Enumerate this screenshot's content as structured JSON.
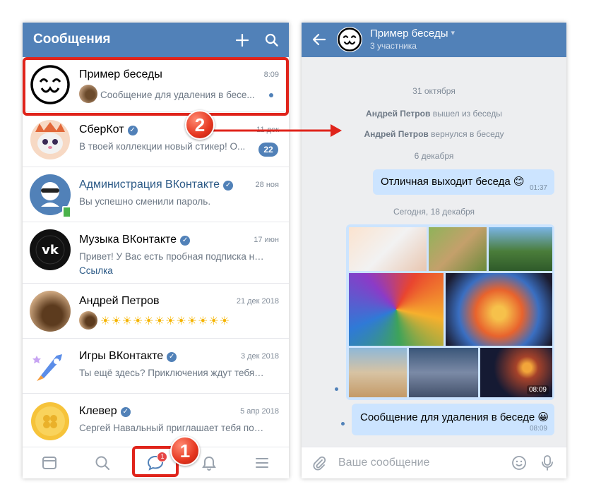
{
  "left": {
    "header_title": "Сообщения",
    "conversations": [
      {
        "name": "Пример беседы",
        "time": "8:09",
        "preview": "Сообщение для удаления в бесе..."
      },
      {
        "name": "СберКот",
        "time": "11 дек",
        "preview": "В твоей коллекции новый стикер! О...",
        "unread": "22"
      },
      {
        "name": "Администрация ВКонтакте",
        "time": "28 ноя",
        "preview": "Вы успешно сменили пароль."
      },
      {
        "name": "Музыка ВКонтакте",
        "time": "17 июн",
        "preview": "Привет! У Вас есть пробная подписка на о...",
        "link": "Ссылка"
      },
      {
        "name": "Андрей Петров",
        "time": "21 дек 2018",
        "preview": "☀☀☀☀☀☀☀☀☀☀☀☀"
      },
      {
        "name": "Игры ВКонтакте",
        "time": "3 дек 2018",
        "preview": "Ты ещё здесь? Приключения ждут тебя. Н..."
      },
      {
        "name": "Клевер",
        "time": "5 апр 2018",
        "preview": "Сергей Навальный приглашает тебя пора..."
      }
    ],
    "nav_badge": "1"
  },
  "steps": {
    "one": "1",
    "two": "2"
  },
  "right": {
    "chat_title": "Пример беседы",
    "chat_subtitle": "3 участника",
    "sys1": "31 октября",
    "sys2_name": "Андрей Петров",
    "sys2_text": "вышел из беседы",
    "sys3_name": "Андрей Петров",
    "sys3_text": "вернулся в беседу",
    "sys4": "6 декабря",
    "msg1_text": "Отличная выходит беседа 😊",
    "msg1_time": "01:37",
    "sys5": "Сегодня, 18 декабря",
    "photos_time": "08:09",
    "msg2_text": "Сообщение для удаления в беседе 😀",
    "msg2_time": "08:09",
    "composer_placeholder": "Ваше сообщение"
  },
  "colors": {
    "brand": "#5181b8",
    "bubble": "#cce4ff",
    "annotation": "#e0241b"
  }
}
